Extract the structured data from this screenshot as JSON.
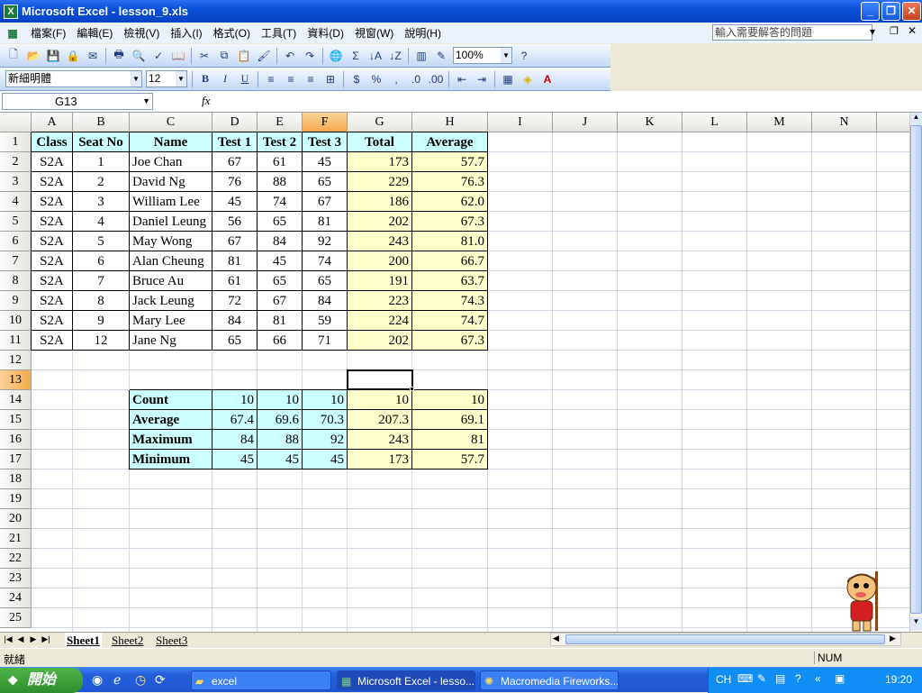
{
  "window": {
    "title": "Microsoft Excel - lesson_9.xls",
    "app_icon": "X"
  },
  "menu": {
    "items": [
      "檔案(F)",
      "編輯(E)",
      "檢視(V)",
      "插入(I)",
      "格式(O)",
      "工具(T)",
      "資料(D)",
      "視窗(W)",
      "說明(H)"
    ],
    "help_placeholder": "輸入需要解答的問題"
  },
  "standard_toolbar": {
    "zoom": "100%"
  },
  "formatting_toolbar": {
    "font": "新細明體",
    "size": "12"
  },
  "formula_bar": {
    "name_box": "G13",
    "fx": "fx",
    "formula": ""
  },
  "columns": [
    "A",
    "B",
    "C",
    "D",
    "E",
    "F",
    "G",
    "H",
    "I",
    "J",
    "K",
    "L",
    "M",
    "N"
  ],
  "rows": [
    "1",
    "2",
    "3",
    "4",
    "5",
    "6",
    "7",
    "8",
    "9",
    "10",
    "11",
    "12",
    "13",
    "14",
    "15",
    "16",
    "17",
    "18",
    "19",
    "20",
    "21",
    "22",
    "23",
    "24",
    "25"
  ],
  "headers": [
    "Class",
    "Seat No",
    "Name",
    "Test 1",
    "Test 2",
    "Test 3",
    "Total",
    "Average"
  ],
  "students": [
    [
      "S2A",
      "1",
      "Joe Chan",
      "67",
      "61",
      "45",
      "173",
      "57.7"
    ],
    [
      "S2A",
      "2",
      "David Ng",
      "76",
      "88",
      "65",
      "229",
      "76.3"
    ],
    [
      "S2A",
      "3",
      "William Lee",
      "45",
      "74",
      "67",
      "186",
      "62.0"
    ],
    [
      "S2A",
      "4",
      "Daniel Leung",
      "56",
      "65",
      "81",
      "202",
      "67.3"
    ],
    [
      "S2A",
      "5",
      "May Wong",
      "67",
      "84",
      "92",
      "243",
      "81.0"
    ],
    [
      "S2A",
      "6",
      "Alan Cheung",
      "81",
      "45",
      "74",
      "200",
      "66.7"
    ],
    [
      "S2A",
      "7",
      "Bruce Au",
      "61",
      "65",
      "65",
      "191",
      "63.7"
    ],
    [
      "S2A",
      "8",
      "Jack Leung",
      "72",
      "67",
      "84",
      "223",
      "74.3"
    ],
    [
      "S2A",
      "9",
      "Mary Lee",
      "84",
      "81",
      "59",
      "224",
      "74.7"
    ],
    [
      "S2A",
      "12",
      "Jane Ng",
      "65",
      "66",
      "71",
      "202",
      "67.3"
    ]
  ],
  "stats": [
    [
      "Count",
      "10",
      "10",
      "10",
      "10",
      "10"
    ],
    [
      "Average",
      "67.4",
      "69.6",
      "70.3",
      "207.3",
      "69.1"
    ],
    [
      "Maximum",
      "84",
      "88",
      "92",
      "243",
      "81"
    ],
    [
      "Minimum",
      "45",
      "45",
      "45",
      "173",
      "57.7"
    ]
  ],
  "sheets": [
    "Sheet1",
    "Sheet2",
    "Sheet3"
  ],
  "status": {
    "ready": "就緒",
    "num": "NUM"
  },
  "taskbar": {
    "start": "開始",
    "tasks": [
      "excel",
      "Microsoft Excel - lesso...",
      "Macromedia Fireworks..."
    ],
    "lang": "CH",
    "clock": "19:20"
  },
  "colors": {
    "header_fill": "#ccffff",
    "total_fill": "#ffffcc",
    "selection_header": "#f5a94a"
  }
}
